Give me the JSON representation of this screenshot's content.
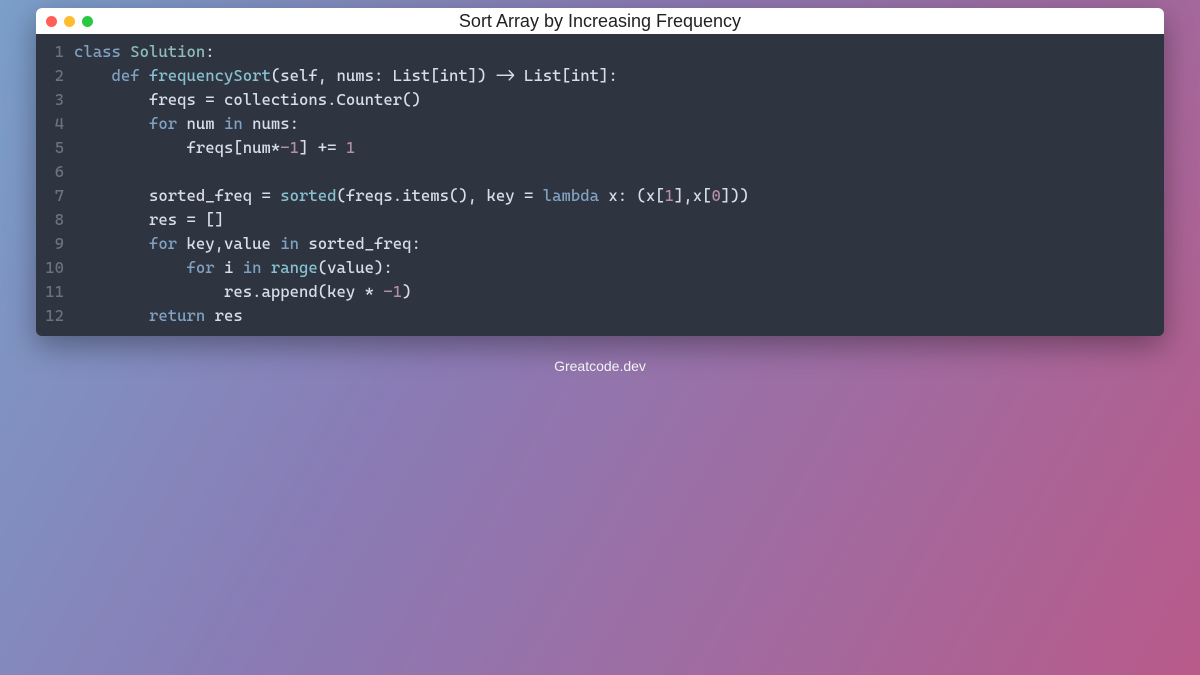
{
  "window": {
    "title": "Sort Array by Increasing Frequency"
  },
  "lineNumbers": [
    "1",
    "2",
    "3",
    "4",
    "5",
    "6",
    "7",
    "8",
    "9",
    "10",
    "11",
    "12"
  ],
  "code": {
    "l1": {
      "kw1": "class",
      "cls": "Solution",
      "colon": ":"
    },
    "l2": {
      "kw1": "def",
      "fn": "frequencySort",
      "args": "(self, nums: List[int]) -> List[int]:"
    },
    "l3": {
      "txt": "freqs = collections.Counter()"
    },
    "l4": {
      "kw1": "for",
      "v": "num",
      "kw2": "in",
      "it": "nums:"
    },
    "l5": {
      "txt_a": "freqs[num*",
      "neg": "-1",
      "txt_b": "] += ",
      "one": "1"
    },
    "l6": {
      "txt": ""
    },
    "l7": {
      "txt_a": "sorted_freq = ",
      "fn": "sorted",
      "txt_b": "(freqs.items(), key = ",
      "kw": "lambda",
      "txt_c": " x: (x[",
      "n1": "1",
      "txt_d": "],x[",
      "n0": "0",
      "txt_e": "]))"
    },
    "l8": {
      "txt": "res = []"
    },
    "l9": {
      "kw1": "for",
      "v": "key,value",
      "kw2": "in",
      "it": "sorted_freq:"
    },
    "l10": {
      "kw1": "for",
      "v": "i",
      "kw2": "in",
      "fn": "range",
      "txt": "(value):"
    },
    "l11": {
      "txt_a": "res.append(key * ",
      "neg": "-1",
      "txt_b": ")"
    },
    "l12": {
      "kw1": "return",
      "v": "res"
    }
  },
  "footer": "Greatcode.dev"
}
